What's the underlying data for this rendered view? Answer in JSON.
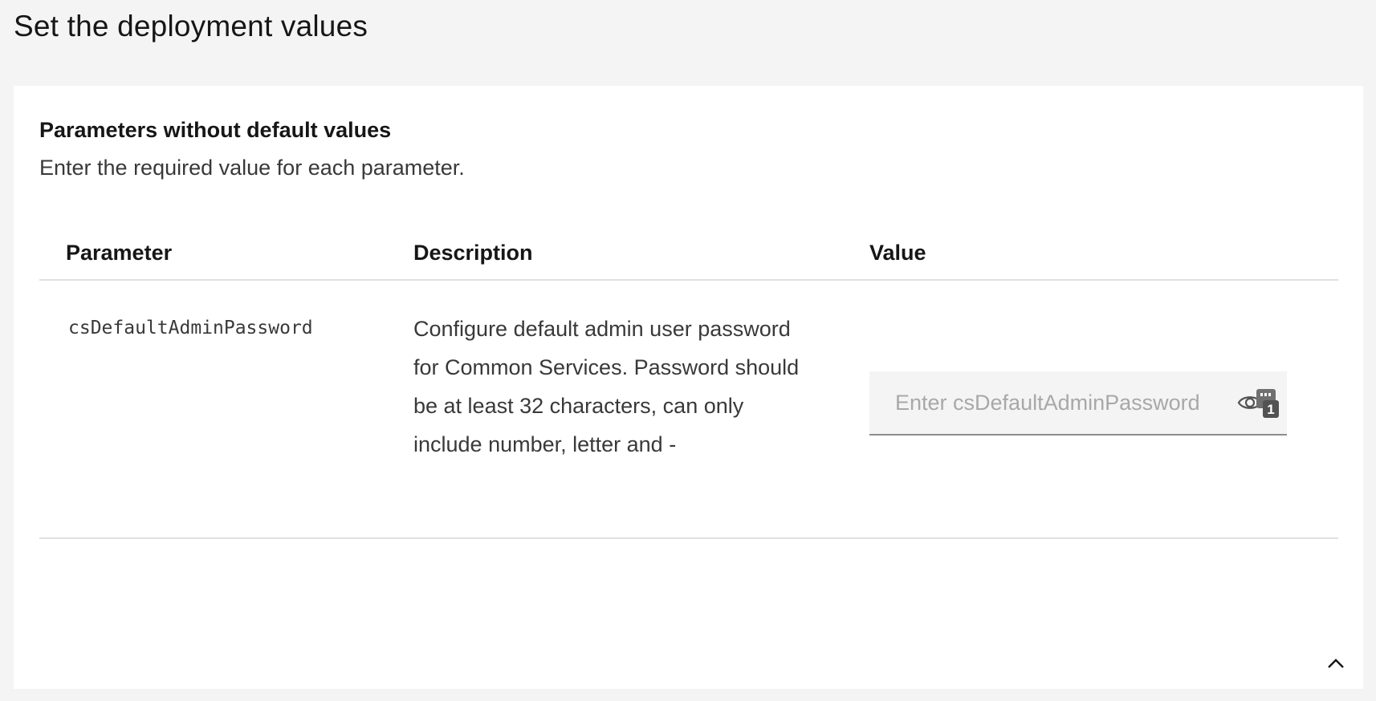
{
  "page": {
    "title": "Set the deployment values"
  },
  "section": {
    "title": "Parameters without default values",
    "subtitle": "Enter the required value for each parameter."
  },
  "table": {
    "headers": {
      "parameter": "Parameter",
      "description": "Description",
      "value": "Value"
    },
    "rows": [
      {
        "parameter": "csDefaultAdminPassword",
        "description": "Configure default admin user password for Common Services. Password should be at least 32 characters, can only include number, letter and -",
        "value": "",
        "placeholder": "Enter csDefaultAdminPassword",
        "badge_count": "1"
      }
    ]
  },
  "icons": {
    "reveal": "eye-icon",
    "badge": "password-manager-badge-icon",
    "collapse": "chevron-up-icon"
  }
}
